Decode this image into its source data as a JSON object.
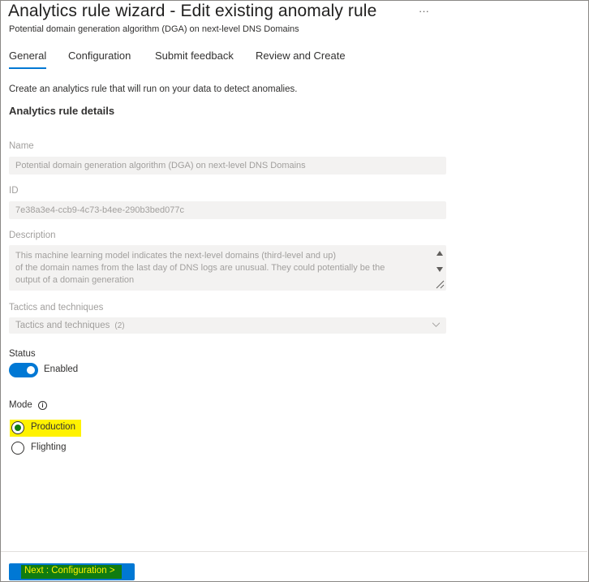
{
  "header": {
    "title": "Analytics rule wizard - Edit existing anomaly rule",
    "more_label": "···",
    "subtitle": "Potential domain generation algorithm (DGA) on next-level DNS Domains"
  },
  "tabs": [
    {
      "label": "General",
      "active": true
    },
    {
      "label": "Configuration",
      "active": false
    },
    {
      "label": "Submit feedback",
      "active": false
    },
    {
      "label": "Review and Create",
      "active": false
    }
  ],
  "intro_text": "Create an analytics rule that will run on your data to detect anomalies.",
  "section_title": "Analytics rule details",
  "name_field": {
    "label": "Name",
    "value": "Potential domain generation algorithm (DGA) on next-level DNS Domains"
  },
  "id_field": {
    "label": "ID",
    "value": "7e38a3e4-ccb9-4c73-b4ee-290b3bed077c"
  },
  "description_field": {
    "label": "Description",
    "lines": [
      "This machine learning model indicates the next-level domains (third-level and up)",
      "of the domain names from the last day of DNS logs are unusual. They could potentially be the",
      "output of a domain generation"
    ]
  },
  "tactics_field": {
    "label": "Tactics and techniques",
    "placeholder": "Tactics and techniques",
    "count": "(2)"
  },
  "status": {
    "label": "Status",
    "toggle_text": "Enabled",
    "enabled": true
  },
  "mode": {
    "label": "Mode",
    "info_icon": "i",
    "options": [
      {
        "label": "Production",
        "selected": true
      },
      {
        "label": "Flighting",
        "selected": false
      }
    ]
  },
  "footer": {
    "next_button": "Next : Configuration >"
  },
  "colors": {
    "accent": "#0078d4",
    "highlight": "#fff200",
    "selected_radio": "#107c10"
  }
}
